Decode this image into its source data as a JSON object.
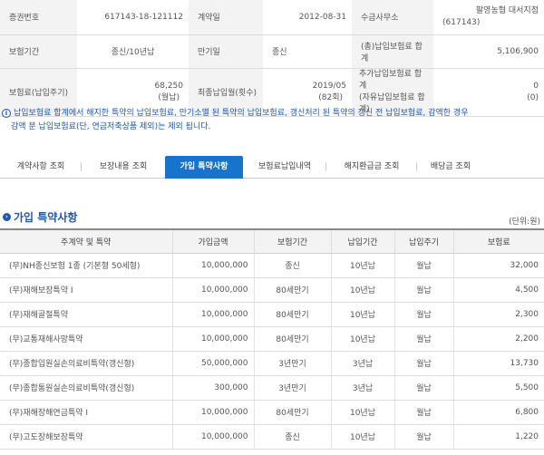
{
  "summary": {
    "policy_no_label": "증권번호",
    "policy_no": "617143-18-121112",
    "contract_date_label": "계약일",
    "contract_date": "2012-08-31",
    "collector_label": "수금사무소",
    "collector_line1": "팔영농협 대서지점",
    "collector_line2": "(617143)",
    "period_label": "보험기간",
    "period": "종신/10년납",
    "maturity_label": "만기일",
    "maturity": "종신",
    "total_premium_label": "(총)납입보험료 합계",
    "total_premium": "5,106,900",
    "premium_label": "보험료(납입주기)",
    "premium_amount": "68,250",
    "premium_cycle": "(월납)",
    "last_payment_label": "최종납입월(횟수)",
    "last_payment_month": "2019/05",
    "last_payment_count": "(82회)",
    "extra_label_line1": "추가납입보험료 합계",
    "extra_label_line2": "(자유납입보험료 합계)",
    "extra_value_1": "0",
    "extra_value_2": "(0)"
  },
  "notice": {
    "icon": "info-icon",
    "line1": "납입보험료 합계에서 해지한 특약의 납입보험료, 만기소멸 된 특약의 납입보험료, 갱신처리 된 특약의 갱신 전 납입보험료, 감액한 경우",
    "line2": "감액 분 납입보험료(단, 연금저축상품 제외)는 제외 됩니다."
  },
  "tabs": [
    {
      "label": "계약사항 조회",
      "active": false
    },
    {
      "label": "보장내용 조회",
      "active": false
    },
    {
      "label": "가입 특약사항",
      "active": true
    },
    {
      "label": "보험료납입내역",
      "active": false
    },
    {
      "label": "해지환급금 조회",
      "active": false
    },
    {
      "label": "배당금 조회",
      "active": false
    }
  ],
  "section": {
    "title": "가입 특약사항",
    "unit": "(단위:원)"
  },
  "riders": {
    "headers": [
      "주계약 및 특약",
      "가입금액",
      "보험기간",
      "납입기간",
      "납입주기",
      "보험료"
    ],
    "rows": [
      [
        "(무)NH종신보험 1종 (기본형 50세형)",
        "10,000,000",
        "종신",
        "10년납",
        "월납",
        "32,000"
      ],
      [
        "(무)재해보장특약 I",
        "10,000,000",
        "80세만기",
        "10년납",
        "월납",
        "4,500"
      ],
      [
        "(무)재해골절특약",
        "10,000,000",
        "80세만기",
        "10년납",
        "월납",
        "2,300"
      ],
      [
        "(무)교통재해사망특약",
        "10,000,000",
        "80세만기",
        "10년납",
        "월납",
        "2,200"
      ],
      [
        "(무)종합입원실손의료비특약(갱신형)",
        "50,000,000",
        "3년만기",
        "3년납",
        "월납",
        "13,730"
      ],
      [
        "(무)종합통원실손의료비특약(갱신형)",
        "300,000",
        "3년만기",
        "3년납",
        "월납",
        "5,500"
      ],
      [
        "(무)재해장해연금특약 I",
        "10,000,000",
        "80세만기",
        "10년납",
        "월납",
        "6,800"
      ],
      [
        "(무)고도장해보장특약",
        "10,000,000",
        "종신",
        "10년납",
        "월납",
        "1,220"
      ]
    ]
  },
  "colors": {
    "accent": "#1773cc",
    "link_text": "#1f56b4",
    "label_bg": "#f3f3f3"
  }
}
